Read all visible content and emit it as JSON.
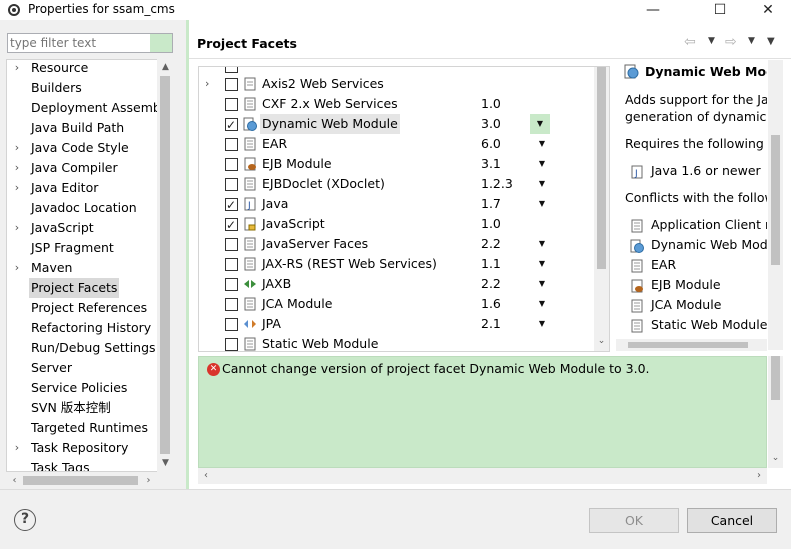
{
  "window": {
    "title": "Properties for ssam_cms",
    "minimize_glyph": "—",
    "maximize_glyph": "☐",
    "close_glyph": "✕"
  },
  "sidebar": {
    "filter_placeholder": "type filter text",
    "items": [
      {
        "label": "Resource",
        "expandable": true
      },
      {
        "label": "Builders",
        "expandable": false
      },
      {
        "label": "Deployment Assembly",
        "expandable": false
      },
      {
        "label": "Java Build Path",
        "expandable": false
      },
      {
        "label": "Java Code Style",
        "expandable": true
      },
      {
        "label": "Java Compiler",
        "expandable": true
      },
      {
        "label": "Java Editor",
        "expandable": true
      },
      {
        "label": "Javadoc Location",
        "expandable": false
      },
      {
        "label": "JavaScript",
        "expandable": true
      },
      {
        "label": "JSP Fragment",
        "expandable": false
      },
      {
        "label": "Maven",
        "expandable": true
      },
      {
        "label": "Project Facets",
        "expandable": false,
        "selected": true
      },
      {
        "label": "Project References",
        "expandable": false
      },
      {
        "label": "Refactoring History",
        "expandable": false
      },
      {
        "label": "Run/Debug Settings",
        "expandable": false
      },
      {
        "label": "Server",
        "expandable": false
      },
      {
        "label": "Service Policies",
        "expandable": false
      },
      {
        "label": "SVN 版本控制",
        "expandable": false
      },
      {
        "label": "Targeted Runtimes",
        "expandable": false
      },
      {
        "label": "Task Repository",
        "expandable": true
      },
      {
        "label": "Task Tags",
        "expandable": false
      }
    ]
  },
  "page": {
    "title": "Project Facets",
    "back_glyph": "⇦",
    "forward_glyph": "⇨",
    "menu_glyph": "▼"
  },
  "facets": {
    "rows": [
      {
        "name": "Axis2 Web Services",
        "version": "",
        "checked": false,
        "expandable": true,
        "icon": "folder-icon",
        "dropdown": false
      },
      {
        "name": "CXF 2.x Web Services",
        "version": "1.0",
        "checked": false,
        "expandable": false,
        "icon": "page-icon",
        "dropdown": false
      },
      {
        "name": "Dynamic Web Module",
        "version": "3.0",
        "checked": true,
        "expandable": false,
        "icon": "globe-page-icon",
        "dropdown": true,
        "highlighted": true,
        "selected": true
      },
      {
        "name": "EAR",
        "version": "6.0",
        "checked": false,
        "expandable": false,
        "icon": "page-icon",
        "dropdown": true
      },
      {
        "name": "EJB Module",
        "version": "3.1",
        "checked": false,
        "expandable": false,
        "icon": "bean-icon",
        "dropdown": true
      },
      {
        "name": "EJBDoclet (XDoclet)",
        "version": "1.2.3",
        "checked": false,
        "expandable": false,
        "icon": "page-icon",
        "dropdown": true
      },
      {
        "name": "Java",
        "version": "1.7",
        "checked": true,
        "expandable": false,
        "icon": "java-icon",
        "dropdown": true
      },
      {
        "name": "JavaScript",
        "version": "1.0",
        "checked": true,
        "expandable": false,
        "icon": "lock-page-icon",
        "dropdown": false
      },
      {
        "name": "JavaServer Faces",
        "version": "2.2",
        "checked": false,
        "expandable": false,
        "icon": "page-icon",
        "dropdown": true
      },
      {
        "name": "JAX-RS (REST Web Services)",
        "version": "1.1",
        "checked": false,
        "expandable": false,
        "icon": "page-icon",
        "dropdown": true
      },
      {
        "name": "JAXB",
        "version": "2.2",
        "checked": false,
        "expandable": false,
        "icon": "jaxb-icon",
        "dropdown": true
      },
      {
        "name": "JCA Module",
        "version": "1.6",
        "checked": false,
        "expandable": false,
        "icon": "page-icon",
        "dropdown": true
      },
      {
        "name": "JPA",
        "version": "2.1",
        "checked": false,
        "expandable": false,
        "icon": "jpa-icon",
        "dropdown": true
      },
      {
        "name": "Static Web Module",
        "version": "",
        "checked": false,
        "expandable": false,
        "icon": "page-icon",
        "dropdown": false
      }
    ]
  },
  "details": {
    "title": "Dynamic Web Module",
    "description_lines": [
      "Adds support for the Java",
      "generation of dynamic W"
    ],
    "requires_label": "Requires the following fa",
    "requires": [
      {
        "label": "Java 1.6 or newer",
        "icon": "java-icon"
      }
    ],
    "conflicts_label": "Conflicts with the followi",
    "conflicts": [
      {
        "label": "Application Client m",
        "icon": "page-icon"
      },
      {
        "label": "Dynamic Web Modu",
        "icon": "globe-page-icon"
      },
      {
        "label": "EAR",
        "icon": "page-icon"
      },
      {
        "label": "EJB Module",
        "icon": "bean-icon"
      },
      {
        "label": "JCA Module",
        "icon": "page-icon"
      },
      {
        "label": "Static Web Module",
        "icon": "page-icon"
      }
    ]
  },
  "message": {
    "text": "Cannot change version of project facet Dynamic Web Module to 3.0.",
    "icon": "error-icon"
  },
  "buttons": {
    "help_glyph": "?",
    "ok_label": "OK",
    "cancel_label": "Cancel"
  },
  "colors": {
    "accent_green": "#c9e9c9",
    "error_red": "#d9342b"
  }
}
